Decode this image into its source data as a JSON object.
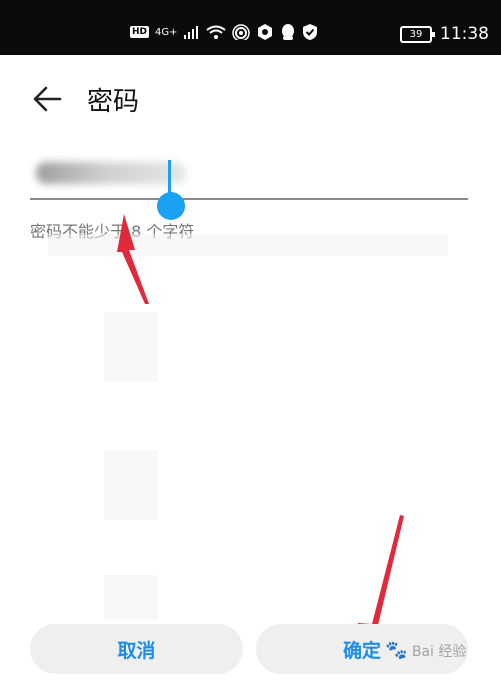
{
  "status_bar": {
    "network_badge": "HD",
    "network_type": "4G+",
    "battery": "39",
    "time": "11:38"
  },
  "header": {
    "title": "密码"
  },
  "password": {
    "value": "",
    "hint": "密码不能少于 8 个字符"
  },
  "buttons": {
    "cancel": "取消",
    "ok": "确定"
  },
  "colors": {
    "accent": "#1a8ee8",
    "cursor_handle": "#1aa1f1",
    "annotation_arrow": "#e0293a"
  },
  "watermark": {
    "text": "Bai 经验"
  }
}
